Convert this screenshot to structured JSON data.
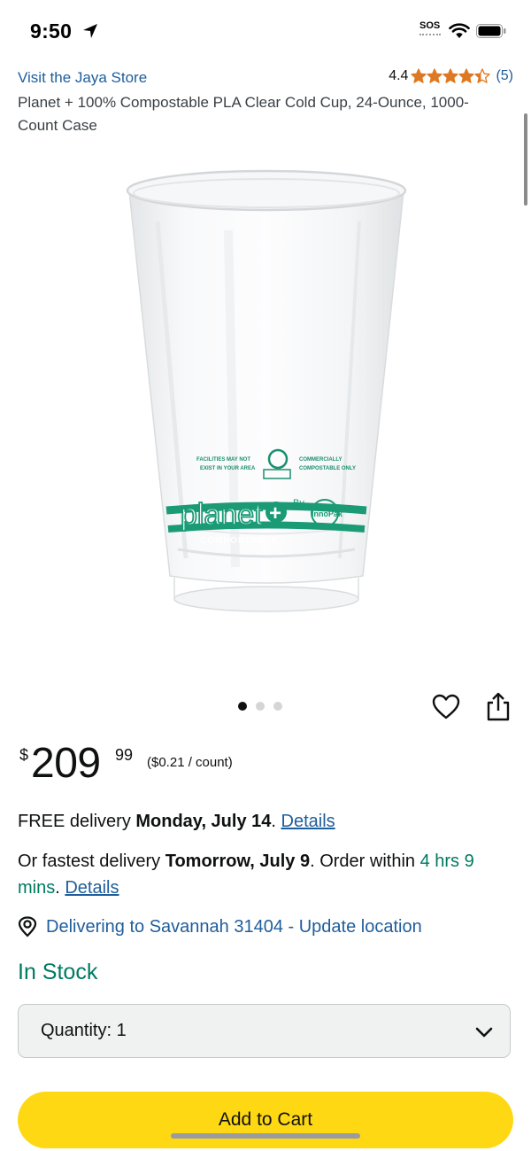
{
  "status_bar": {
    "time": "9:50",
    "sos": "SOS"
  },
  "store": {
    "link": "Visit the Jaya Store",
    "rating": "4.4",
    "stars_filled": 4.4,
    "rating_count": "(5)"
  },
  "product": {
    "title": "Planet + 100% Compostable PLA Clear Cold Cup, 24-Ounce, 1000-Count Case"
  },
  "image": {
    "print_planet": "planet",
    "print_plus": "+",
    "print_by": "By",
    "print_brand": "InnoPak",
    "print_compostable": "COMPOSTABLE"
  },
  "carousel": {
    "total": 3,
    "active": 0
  },
  "price": {
    "symbol": "$",
    "whole": "209",
    "fraction": "99",
    "unit": "($0.21 / count)"
  },
  "delivery": {
    "prefix": "FREE delivery ",
    "date": "Monday, July 14",
    "suffix": ". ",
    "details": "Details"
  },
  "fastest": {
    "prefix": "Or fastest delivery ",
    "date": "Tomorrow, July 9",
    "middle": ". Order within ",
    "time": "4 hrs 9 mins",
    "suffix": ". ",
    "details": "Details"
  },
  "location": {
    "text": "Delivering to Savannah 31404 - Update location"
  },
  "stock": {
    "status": "In Stock"
  },
  "quantity": {
    "label": "Quantity:",
    "value": "1"
  },
  "cart": {
    "label": "Add to Cart"
  },
  "colors": {
    "link": "#1f5d9b",
    "stock": "#007a61",
    "star": "#de7921",
    "cart_button": "#ffd814"
  }
}
